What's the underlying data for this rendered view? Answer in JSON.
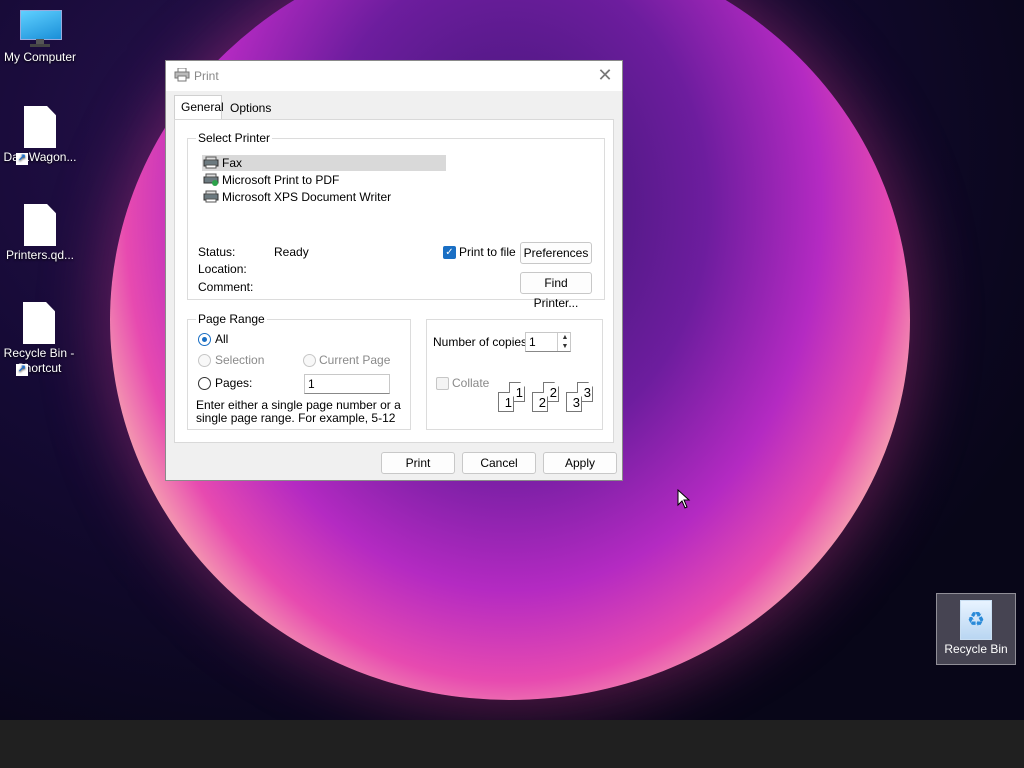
{
  "desktop": {
    "icons": [
      {
        "label": "My Computer"
      },
      {
        "label": "DataWagon..."
      },
      {
        "label": "Printers.qd..."
      },
      {
        "label": "Recycle Bin - Shortcut"
      }
    ],
    "recycle_bin": {
      "label": "Recycle Bin"
    }
  },
  "dialog": {
    "title": "Print",
    "tabs": [
      {
        "label": "General"
      },
      {
        "label": "Options"
      }
    ],
    "select_printer": {
      "label": "Select Printer",
      "printers": [
        {
          "name": "Fax",
          "selected": true
        },
        {
          "name": "Microsoft Print to PDF"
        },
        {
          "name": "Microsoft XPS Document Writer"
        }
      ],
      "status_label": "Status:",
      "status_value": "Ready",
      "location_label": "Location:",
      "comment_label": "Comment:",
      "print_to_file_label": "Print to file",
      "print_to_file_checked": true,
      "preferences_label": "Preferences",
      "find_printer_label": "Find Printer..."
    },
    "page_range": {
      "label": "Page Range",
      "all_label": "All",
      "selection_label": "Selection",
      "current_page_label": "Current Page",
      "pages_label": "Pages:",
      "pages_value": "1",
      "hint": "Enter either a single page number or a single page range.  For example, 5-12"
    },
    "copies": {
      "label": "Number of copies:",
      "value": "1",
      "collate_label": "Collate"
    },
    "collate_pages": [
      "1",
      "1",
      "2",
      "2",
      "3",
      "3"
    ],
    "buttons": {
      "print": "Print",
      "cancel": "Cancel",
      "apply": "Apply"
    }
  },
  "icons": {
    "close": "close-icon",
    "printer": "printer-icon"
  }
}
